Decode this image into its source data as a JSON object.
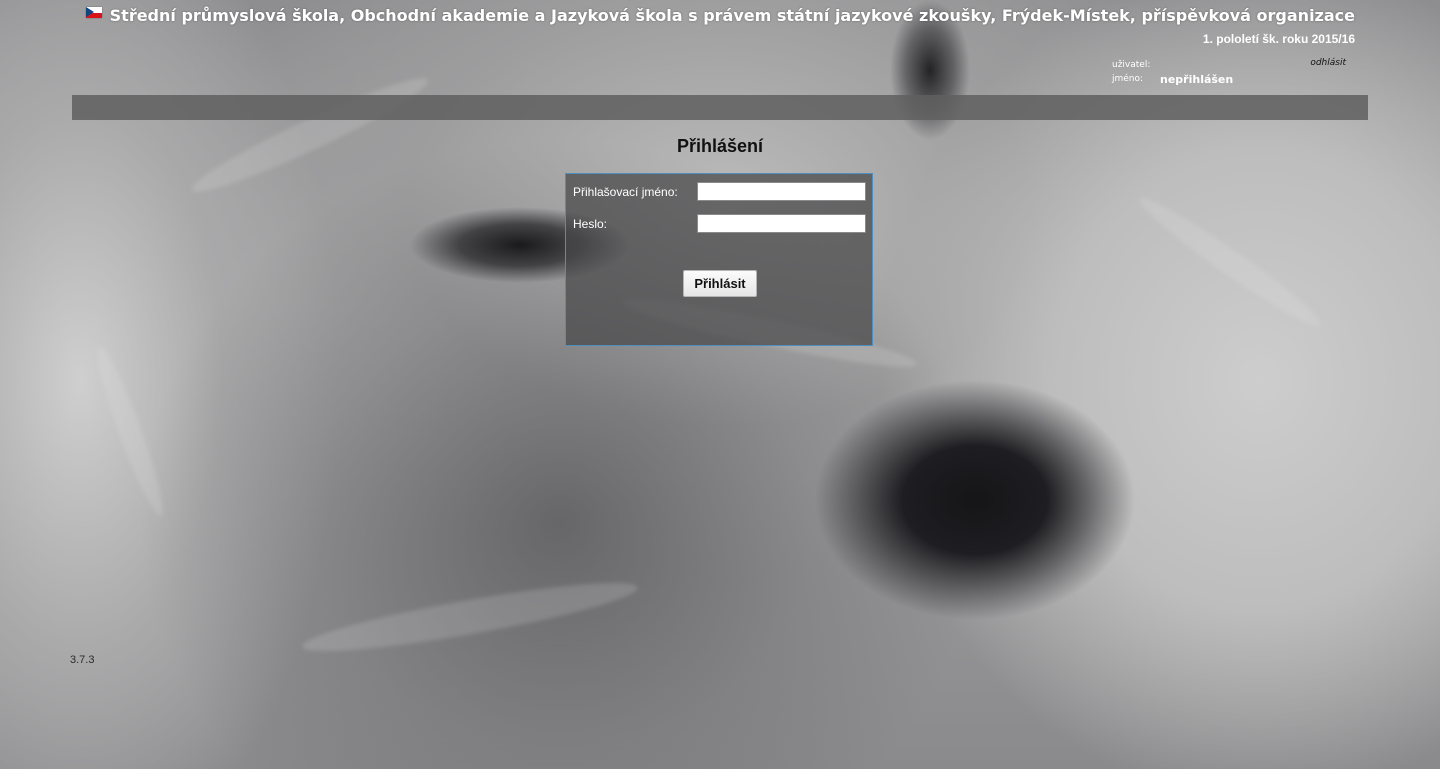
{
  "header": {
    "school_name": "Střední průmyslová škola, Obchodní akademie a Jazyková škola s právem státní jazykové zkoušky, Frýdek-Místek, příspěvková organizace",
    "term": "1. pololetí šk. roku 2015/16",
    "flag_icon": "czech-flag-icon"
  },
  "user": {
    "user_label": "uživatel:",
    "user_value": "",
    "logout_label": "odhlásit",
    "name_label": "jméno:",
    "name_value": "nepřihlášen"
  },
  "login": {
    "heading": "Přihlášení",
    "username_label": "Přihlašovací jméno:",
    "username_value": "",
    "password_label": "Heslo:",
    "password_value": "",
    "submit_label": "Přihlásit"
  },
  "footer": {
    "version": "3.7.3"
  },
  "colors": {
    "login_box_border": "#4f8fbf",
    "menu_bar": "#5f5f5f",
    "text_light": "#ffffff"
  }
}
